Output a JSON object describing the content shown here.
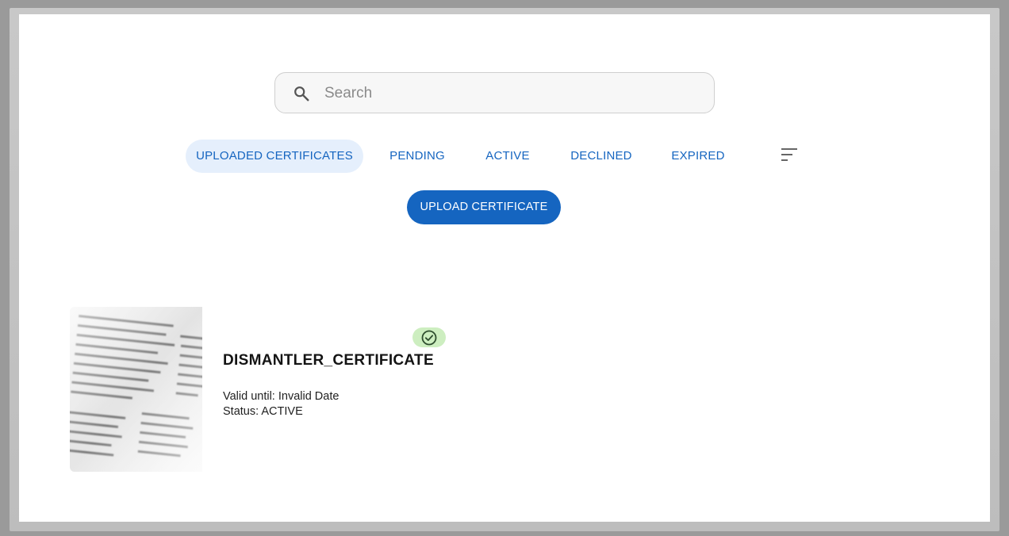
{
  "search": {
    "placeholder": "Search",
    "icon": "search-icon"
  },
  "tabs": [
    {
      "label": "UPLOADED CERTIFICATES",
      "selected": true
    },
    {
      "label": "PENDING",
      "selected": false
    },
    {
      "label": "ACTIVE",
      "selected": false
    },
    {
      "label": "DECLINED",
      "selected": false
    },
    {
      "label": "EXPIRED",
      "selected": false
    }
  ],
  "sort_icon": "sort-icon",
  "upload_button": {
    "label": "UPLOAD CERTIFICATE"
  },
  "certificates": [
    {
      "name": "DISMANTLER_CERTIFICATE",
      "valid_until": "Valid until: Invalid Date",
      "status": "Status: ACTIVE",
      "status_icon": "check-circle-icon",
      "thumbnail": "document-thumbnail"
    }
  ],
  "colors": {
    "primary": "#1565c0",
    "tab_selected_bg": "#e5effc",
    "badge_bg": "#cdeec0",
    "badge_icon": "#2e7d32"
  }
}
